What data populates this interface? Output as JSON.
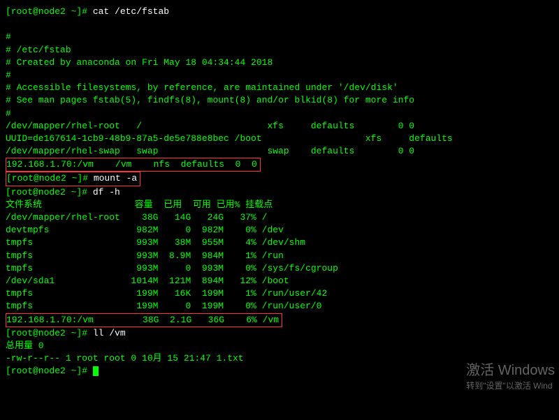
{
  "prompt": "[root@node2 ~]# ",
  "cmds": {
    "cat": "cat /etc/fstab",
    "mount": "mount -a",
    "df": "df -h",
    "ll": "ll /vm"
  },
  "fstab": {
    "l1": "#",
    "l2": "# /etc/fstab",
    "l3": "# Created by anaconda on Fri May 18 04:34:44 2018",
    "l4": "#",
    "l5": "# Accessible filesystems, by reference, are maintained under '/dev/disk'",
    "l6": "# See man pages fstab(5), findfs(8), mount(8) and/or blkid(8) for more info",
    "l7": "#",
    "e1": "/dev/mapper/rhel-root   /                       xfs     defaults        0 0",
    "e2": "UUID=de167614-1cb9-48b9-87a5-de5e788e8bec /boot                   xfs     defaults",
    "e3": "/dev/mapper/rhel-swap   swap                    swap    defaults        0 0",
    "hl": "192.168.1.70:/vm    /vm    nfs  defaults  0  0"
  },
  "df": {
    "head": "文件系统                 容量  已用  可用 已用% 挂载点",
    "rows": [
      "/dev/mapper/rhel-root    38G   14G   24G   37% /",
      "devtmpfs                982M     0  982M    0% /dev",
      "tmpfs                   993M   38M  955M    4% /dev/shm",
      "tmpfs                   993M  8.9M  984M    1% /run",
      "tmpfs                   993M     0  993M    0% /sys/fs/cgroup",
      "/dev/sda1              1014M  121M  894M   12% /boot",
      "tmpfs                   199M   16K  199M    1% /run/user/42",
      "tmpfs                   199M     0  199M    0% /run/user/0"
    ],
    "hl": "192.168.1.70:/vm         38G  2.1G   36G    6% /vm"
  },
  "ll": {
    "total": "总用量 0",
    "entry": "-rw-r--r-- 1 root root 0 10月 15 21:47 1.txt"
  },
  "watermark": {
    "line1": "激活 Windows",
    "line2": "转到\"设置\"以激活 Wind"
  }
}
